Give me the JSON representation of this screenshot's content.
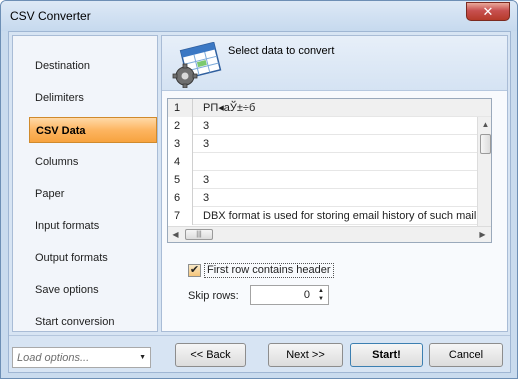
{
  "window": {
    "title": "CSV Converter",
    "close_glyph": "✕"
  },
  "sidebar": {
    "items": [
      {
        "label": "Destination",
        "active": false
      },
      {
        "label": "Delimiters",
        "active": false
      },
      {
        "label": "CSV Data",
        "active": true
      },
      {
        "label": "Columns",
        "active": false
      },
      {
        "label": "Paper",
        "active": false
      },
      {
        "label": "Input formats",
        "active": false
      },
      {
        "label": "Output formats",
        "active": false
      },
      {
        "label": "Save options",
        "active": false
      },
      {
        "label": "Start conversion",
        "active": false
      }
    ]
  },
  "main": {
    "header": {
      "text": "Select data to convert",
      "icon": "table-gear-icon"
    },
    "grid": {
      "rows": [
        {
          "num": "1",
          "value": "РП◂аЎ±÷б"
        },
        {
          "num": "2",
          "value": "3"
        },
        {
          "num": "3",
          "value": "3"
        },
        {
          "num": "4",
          "value": ""
        },
        {
          "num": "5",
          "value": "3"
        },
        {
          "num": "6",
          "value": "3"
        },
        {
          "num": "7",
          "value": "DBX format is used for storing email history of such mail clien"
        }
      ]
    },
    "first_row_header": {
      "label": "First row contains header",
      "checked": true,
      "check_glyph": "✔"
    },
    "skip_rows": {
      "label": "Skip rows:",
      "value": "0"
    }
  },
  "footer": {
    "load_options_placeholder": "Load options...",
    "buttons": {
      "back": "<< Back",
      "next": "Next >>",
      "start": "Start!",
      "cancel": "Cancel"
    }
  },
  "colors": {
    "active_nav": "#fdb561",
    "window_frame": "#c9dbee",
    "close_button": "#c75050"
  }
}
